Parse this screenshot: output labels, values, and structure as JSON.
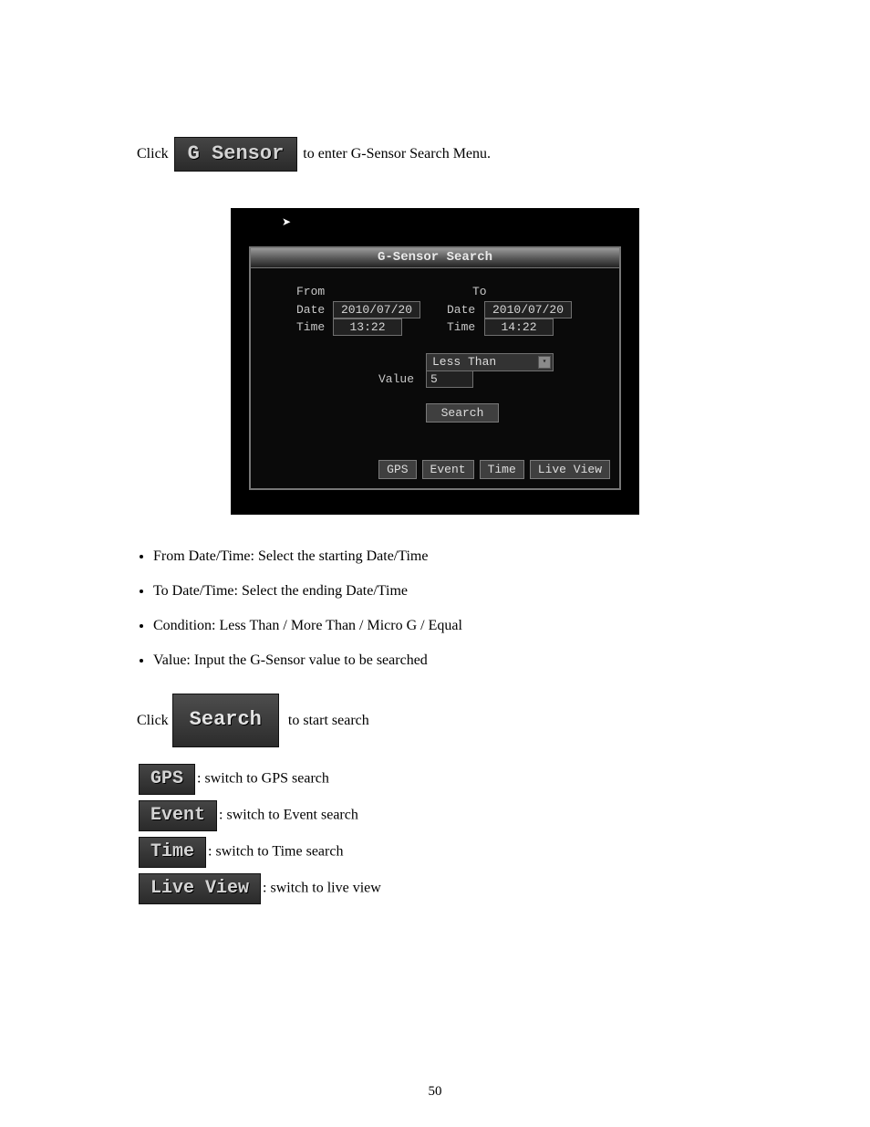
{
  "intro_before": "Click",
  "tag_gsensor": "G Sensor",
  "intro_after": "to enter G-Sensor Search Menu.",
  "panel": {
    "title": "G-Sensor Search",
    "from_label": "From",
    "to_label": "To",
    "date_label": "Date",
    "time_label": "Time",
    "value_label": "Value",
    "from_date": "2010/07/20",
    "from_time": "13:22",
    "to_date": "2010/07/20",
    "to_time": "14:22",
    "condition_select": "Less Than",
    "value_input": "5",
    "search_btn": "Search",
    "btn_gps": "GPS",
    "btn_event": "Event",
    "btn_time": "Time",
    "btn_liveview": "Live View"
  },
  "bullets": {
    "b1": "From Date/Time: Select the starting Date/Time",
    "b2": "To Date/Time: Select the ending Date/Time",
    "b3": "Condition: Less Than / More Than / Micro G / Equal",
    "b4": "Value: Input the G-Sensor value to be searched"
  },
  "search_line_before": "Click",
  "tag_search": "Search",
  "search_line_after": "to start search",
  "tags_footer": {
    "gps": "GPS",
    "gps_after": ": switch to GPS search",
    "event": "Event",
    "event_after": ": switch to Event search",
    "time": "Time",
    "time_after": ": switch to Time search",
    "live": "Live View",
    "live_after": ": switch to live view"
  },
  "page_number": "50"
}
